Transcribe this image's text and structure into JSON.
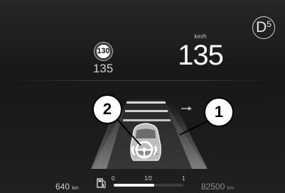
{
  "cluster": {
    "gear_letter": "D",
    "gear_number": "5",
    "speed_limit_sign": "130",
    "speed_limit_value": "135",
    "speed_unit": "km/h",
    "speed_value": "135"
  },
  "callouts": {
    "left": "2",
    "right": "1"
  },
  "footer": {
    "range_value": "640",
    "range_unit": "km",
    "fuel_min_label": "0",
    "fuel_half_label": "1/2",
    "fuel_max_label": "1",
    "fuel_level": 0.58,
    "odometer_value": "82500",
    "odometer_unit": "km"
  },
  "icons": [
    "fuel-pump-icon",
    "steering-wheel-icon",
    "lane-arrow-icon"
  ]
}
